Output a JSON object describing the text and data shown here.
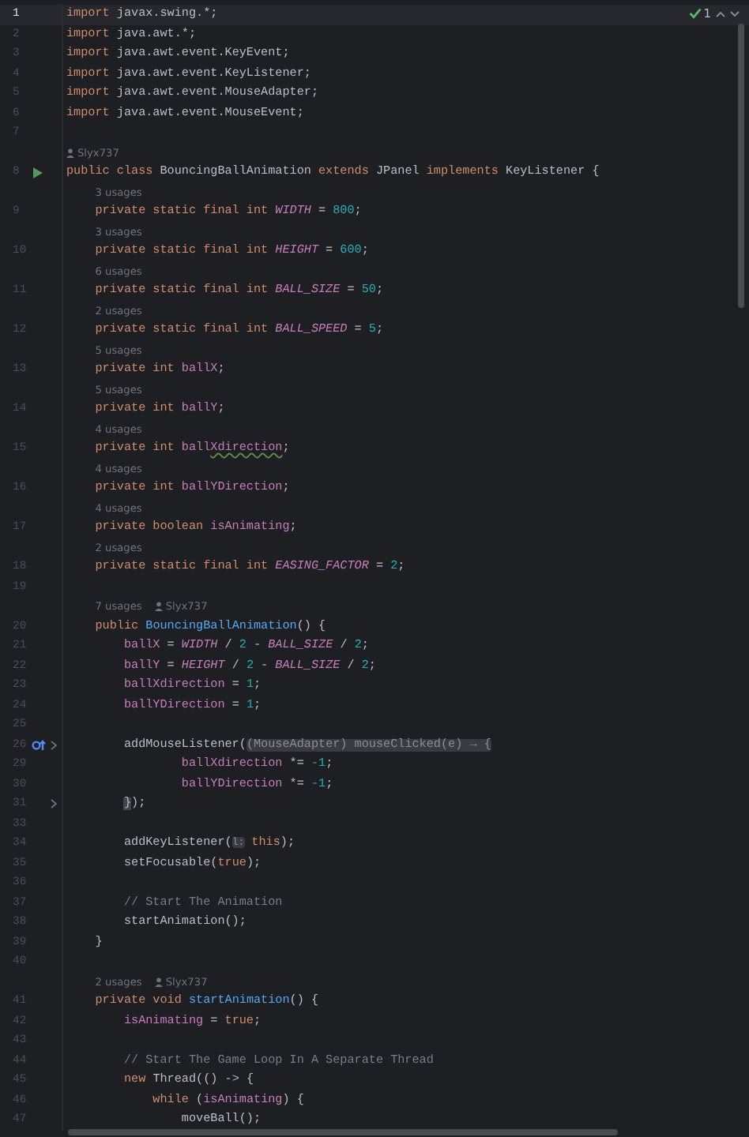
{
  "inspections": {
    "count": "1"
  },
  "lines": [
    {
      "number": "1",
      "kind": "code",
      "current": true,
      "tokens": [
        {
          "text": "import",
          "kind": "keyword"
        },
        {
          "text": " javax.swing.*;",
          "kind": "plain"
        }
      ]
    },
    {
      "number": "2",
      "kind": "code",
      "current": false,
      "tokens": [
        {
          "text": "import",
          "kind": "keyword"
        },
        {
          "text": " java.awt.*;",
          "kind": "plain"
        }
      ]
    },
    {
      "number": "3",
      "kind": "code",
      "current": false,
      "tokens": [
        {
          "text": "import",
          "kind": "keyword"
        },
        {
          "text": " java.awt.event.KeyEvent;",
          "kind": "plain"
        }
      ]
    },
    {
      "number": "4",
      "kind": "code",
      "current": false,
      "tokens": [
        {
          "text": "import",
          "kind": "keyword"
        },
        {
          "text": " java.awt.event.KeyListener;",
          "kind": "plain"
        }
      ]
    },
    {
      "number": "5",
      "kind": "code",
      "current": false,
      "tokens": [
        {
          "text": "import",
          "kind": "keyword"
        },
        {
          "text": " java.awt.event.MouseAdapter;",
          "kind": "plain"
        }
      ]
    },
    {
      "number": "6",
      "kind": "code",
      "current": false,
      "tokens": [
        {
          "text": "import",
          "kind": "keyword"
        },
        {
          "text": " java.awt.event.MouseEvent;",
          "kind": "plain"
        }
      ]
    },
    {
      "number": "7",
      "kind": "code",
      "current": false
    },
    {
      "number": "8",
      "kind": "run",
      "current": false,
      "lens": {
        "author": "Slyx737"
      },
      "tokens": [
        {
          "text": "public class",
          "kind": "keyword"
        },
        {
          "text": " BouncingBallAnimation ",
          "kind": "plain"
        },
        {
          "text": "extends",
          "kind": "keyword"
        },
        {
          "text": " JPanel ",
          "kind": "plain"
        },
        {
          "text": "implements",
          "kind": "keyword"
        },
        {
          "text": " KeyListener {",
          "kind": "plain"
        }
      ]
    },
    {
      "number": "9",
      "kind": "code",
      "current": false,
      "lens": {
        "usages": "3 usages"
      },
      "tokens": [
        {
          "text": "    private static final int ",
          "kind": "keyword"
        },
        {
          "text": "WIDTH",
          "kind": "constant"
        },
        {
          "text": " = ",
          "kind": "plain"
        },
        {
          "text": "800",
          "kind": "number"
        },
        {
          "text": ";",
          "kind": "plain"
        }
      ]
    },
    {
      "number": "10",
      "kind": "code",
      "current": false,
      "lens": {
        "usages": "3 usages"
      },
      "tokens": [
        {
          "text": "    private static final int ",
          "kind": "keyword"
        },
        {
          "text": "HEIGHT",
          "kind": "constant"
        },
        {
          "text": " = ",
          "kind": "plain"
        },
        {
          "text": "600",
          "kind": "number"
        },
        {
          "text": ";",
          "kind": "plain"
        }
      ]
    },
    {
      "number": "11",
      "kind": "code",
      "current": false,
      "lens": {
        "usages": "6 usages"
      },
      "tokens": [
        {
          "text": "    private static final int ",
          "kind": "keyword"
        },
        {
          "text": "BALL_SIZE",
          "kind": "constant"
        },
        {
          "text": " = ",
          "kind": "plain"
        },
        {
          "text": "50",
          "kind": "number"
        },
        {
          "text": ";",
          "kind": "plain"
        }
      ]
    },
    {
      "number": "12",
      "kind": "code",
      "current": false,
      "lens": {
        "usages": "2 usages"
      },
      "tokens": [
        {
          "text": "    private static final int ",
          "kind": "keyword"
        },
        {
          "text": "BALL_SPEED",
          "kind": "constant"
        },
        {
          "text": " = ",
          "kind": "plain"
        },
        {
          "text": "5",
          "kind": "number"
        },
        {
          "text": ";",
          "kind": "plain"
        }
      ]
    },
    {
      "number": "13",
      "kind": "code",
      "current": false,
      "lens": {
        "usages": "5 usages"
      },
      "tokens": [
        {
          "text": "    private int ",
          "kind": "keyword"
        },
        {
          "text": "ballX",
          "kind": "field"
        },
        {
          "text": ";",
          "kind": "plain"
        }
      ]
    },
    {
      "number": "14",
      "kind": "code",
      "current": false,
      "lens": {
        "usages": "5 usages"
      },
      "tokens": [
        {
          "text": "    private int ",
          "kind": "keyword"
        },
        {
          "text": "ballY",
          "kind": "field"
        },
        {
          "text": ";",
          "kind": "plain"
        }
      ]
    },
    {
      "number": "15",
      "kind": "code",
      "current": false,
      "lens": {
        "usages": "4 usages"
      },
      "tokens": [
        {
          "text": "    private int ",
          "kind": "keyword"
        },
        {
          "text": "ball",
          "kind": "field"
        },
        {
          "text": "Xdirection",
          "kind": "typo"
        },
        {
          "text": ";",
          "kind": "plain"
        }
      ]
    },
    {
      "number": "16",
      "kind": "code",
      "current": false,
      "lens": {
        "usages": "4 usages"
      },
      "tokens": [
        {
          "text": "    private int ",
          "kind": "keyword"
        },
        {
          "text": "ballYDirection",
          "kind": "field"
        },
        {
          "text": ";",
          "kind": "plain"
        }
      ]
    },
    {
      "number": "17",
      "kind": "code",
      "current": false,
      "lens": {
        "usages": "4 usages"
      },
      "tokens": [
        {
          "text": "    private boolean ",
          "kind": "keyword"
        },
        {
          "text": "isAnimating",
          "kind": "field"
        },
        {
          "text": ";",
          "kind": "plain"
        }
      ]
    },
    {
      "number": "18",
      "kind": "code",
      "current": false,
      "lens": {
        "usages": "2 usages"
      },
      "tokens": [
        {
          "text": "    private static final int ",
          "kind": "keyword"
        },
        {
          "text": "EASING_FACTOR",
          "kind": "constant"
        },
        {
          "text": " = ",
          "kind": "plain"
        },
        {
          "text": "2",
          "kind": "number"
        },
        {
          "text": ";",
          "kind": "plain"
        }
      ]
    },
    {
      "number": "19",
      "kind": "code",
      "current": false
    },
    {
      "number": "20",
      "kind": "code",
      "current": false,
      "lens": {
        "usages": "7 usages",
        "author": "Slyx737"
      },
      "tokens": [
        {
          "text": "    public ",
          "kind": "keyword"
        },
        {
          "text": "BouncingBallAnimation",
          "kind": "method"
        },
        {
          "text": "() {",
          "kind": "plain"
        }
      ]
    },
    {
      "number": "21",
      "kind": "code",
      "current": false,
      "tokens": [
        {
          "text": "        ballX",
          "kind": "field"
        },
        {
          "text": " = ",
          "kind": "plain"
        },
        {
          "text": "WIDTH",
          "kind": "constant"
        },
        {
          "text": " / ",
          "kind": "plain"
        },
        {
          "text": "2",
          "kind": "number"
        },
        {
          "text": " - ",
          "kind": "plain"
        },
        {
          "text": "BALL_SIZE",
          "kind": "constant"
        },
        {
          "text": " / ",
          "kind": "plain"
        },
        {
          "text": "2",
          "kind": "number"
        },
        {
          "text": ";",
          "kind": "plain"
        }
      ]
    },
    {
      "number": "22",
      "kind": "code",
      "current": false,
      "tokens": [
        {
          "text": "        ballY",
          "kind": "field"
        },
        {
          "text": " = ",
          "kind": "plain"
        },
        {
          "text": "HEIGHT",
          "kind": "constant"
        },
        {
          "text": " / ",
          "kind": "plain"
        },
        {
          "text": "2",
          "kind": "number"
        },
        {
          "text": " - ",
          "kind": "plain"
        },
        {
          "text": "BALL_SIZE",
          "kind": "constant"
        },
        {
          "text": " / ",
          "kind": "plain"
        },
        {
          "text": "2",
          "kind": "number"
        },
        {
          "text": ";",
          "kind": "plain"
        }
      ]
    },
    {
      "number": "23",
      "kind": "code",
      "current": false,
      "tokens": [
        {
          "text": "        ballXdirection",
          "kind": "field"
        },
        {
          "text": " = ",
          "kind": "plain"
        },
        {
          "text": "1",
          "kind": "number"
        },
        {
          "text": ";",
          "kind": "plain"
        }
      ]
    },
    {
      "number": "24",
      "kind": "code",
      "current": false,
      "tokens": [
        {
          "text": "        ballYDirection",
          "kind": "field"
        },
        {
          "text": " = ",
          "kind": "plain"
        },
        {
          "text": "1",
          "kind": "number"
        },
        {
          "text": ";",
          "kind": "plain"
        }
      ]
    },
    {
      "number": "25",
      "kind": "code",
      "current": false
    },
    {
      "number": "26",
      "kind": "override_fold",
      "current": false,
      "tokens": [
        {
          "text": "        addMouseListener(",
          "kind": "plain"
        },
        {
          "text": "(MouseAdapter) mouseClicked(e) → {",
          "kind": "folded"
        }
      ]
    },
    {
      "number": "29",
      "kind": "code",
      "current": false,
      "tokens": [
        {
          "text": "                ballXdirection",
          "kind": "field"
        },
        {
          "text": " *= ",
          "kind": "plain"
        },
        {
          "text": "-1",
          "kind": "number"
        },
        {
          "text": ";",
          "kind": "plain"
        }
      ]
    },
    {
      "number": "30",
      "kind": "code",
      "current": false,
      "tokens": [
        {
          "text": "                ballYDirection",
          "kind": "field"
        },
        {
          "text": " *= ",
          "kind": "plain"
        },
        {
          "text": "-1",
          "kind": "number"
        },
        {
          "text": ";",
          "kind": "plain"
        }
      ]
    },
    {
      "number": "31",
      "kind": "fold",
      "current": false,
      "tokens": [
        {
          "text": "        }",
          "kind": "bracket"
        },
        {
          "text": ");",
          "kind": "plain"
        }
      ]
    },
    {
      "number": "33",
      "kind": "code",
      "current": false
    },
    {
      "number": "34",
      "kind": "code",
      "current": false,
      "tokens": [
        {
          "text": "        addKeyListener(",
          "kind": "plain"
        },
        {
          "text": "l:",
          "kind": "hint"
        },
        {
          "text": " this",
          "kind": "keyword"
        },
        {
          "text": ");",
          "kind": "plain"
        }
      ]
    },
    {
      "number": "35",
      "kind": "code",
      "current": false,
      "tokens": [
        {
          "text": "        setFocusable(",
          "kind": "plain"
        },
        {
          "text": "true",
          "kind": "keyword"
        },
        {
          "text": ");",
          "kind": "plain"
        }
      ]
    },
    {
      "number": "36",
      "kind": "code",
      "current": false
    },
    {
      "number": "37",
      "kind": "code",
      "current": false,
      "tokens": [
        {
          "text": "        // Start The Animation",
          "kind": "comment"
        }
      ]
    },
    {
      "number": "38",
      "kind": "code",
      "current": false,
      "tokens": [
        {
          "text": "        startAnimation();",
          "kind": "plain"
        }
      ]
    },
    {
      "number": "39",
      "kind": "code",
      "current": false,
      "tokens": [
        {
          "text": "    }",
          "kind": "plain"
        }
      ]
    },
    {
      "number": "40",
      "kind": "code",
      "current": false
    },
    {
      "number": "41",
      "kind": "code",
      "current": false,
      "lens": {
        "usages": "2 usages",
        "author": "Slyx737"
      },
      "tokens": [
        {
          "text": "    private void ",
          "kind": "keyword"
        },
        {
          "text": "startAnimation",
          "kind": "method"
        },
        {
          "text": "() {",
          "kind": "plain"
        }
      ]
    },
    {
      "number": "42",
      "kind": "code",
      "current": false,
      "tokens": [
        {
          "text": "        isAnimating",
          "kind": "field"
        },
        {
          "text": " = ",
          "kind": "plain"
        },
        {
          "text": "true",
          "kind": "keyword"
        },
        {
          "text": ";",
          "kind": "plain"
        }
      ]
    },
    {
      "number": "43",
      "kind": "code",
      "current": false
    },
    {
      "number": "44",
      "kind": "code",
      "current": false,
      "tokens": [
        {
          "text": "        // Start The Game Loop In A Separate Thread",
          "kind": "comment"
        }
      ]
    },
    {
      "number": "45",
      "kind": "code",
      "current": false,
      "tokens": [
        {
          "text": "        new",
          "kind": "keyword"
        },
        {
          "text": " Thread(() -> {",
          "kind": "plain"
        }
      ]
    },
    {
      "number": "46",
      "kind": "code",
      "current": false,
      "tokens": [
        {
          "text": "            while",
          "kind": "keyword"
        },
        {
          "text": " (",
          "kind": "plain"
        },
        {
          "text": "isAnimating",
          "kind": "field"
        },
        {
          "text": ") {",
          "kind": "plain"
        }
      ]
    },
    {
      "number": "47",
      "kind": "code",
      "current": false,
      "tokens": [
        {
          "text": "                moveBall();",
          "kind": "plain"
        }
      ]
    }
  ]
}
